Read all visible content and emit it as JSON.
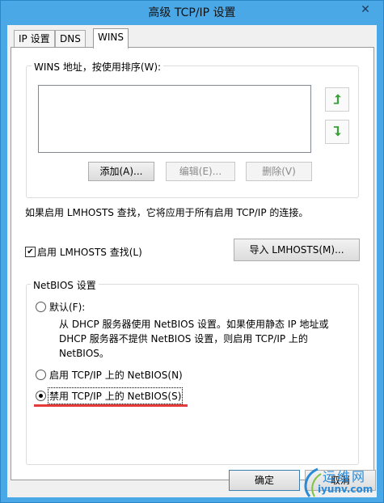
{
  "window": {
    "title": "高级 TCP/IP 设置",
    "close_label": "✕"
  },
  "tabs": [
    {
      "label": "IP 设置"
    },
    {
      "label": "DNS"
    },
    {
      "label": "WINS"
    }
  ],
  "wins_group": {
    "label": "WINS 地址，按使用排序(W):",
    "add_label": "添加(A)...",
    "edit_label": "编辑(E)...",
    "remove_label": "删除(V)"
  },
  "lmhosts_info": "如果启用 LMHOSTS 查找，它将应用于所有启用 TCP/IP 的连接。",
  "lmhosts_check": {
    "label": "启用 LMHOSTS 查找(L)",
    "checked": true
  },
  "import_label": "导入 LMHOSTS(M)...",
  "netbios_group": {
    "label": "NetBIOS 设置",
    "default_label": "默认(F):",
    "default_desc": [
      "从 DHCP 服务器使用 NetBIOS 设置。如果使用静态 IP 地址或",
      "DHCP 服务器不提供 NetBIOS 设置，则启用 TCP/IP 上的",
      "NetBIOS。"
    ],
    "enable_label": "启用 TCP/IP 上的 NetBIOS(N)",
    "disable_label": "禁用 TCP/IP 上的 NetBIOS(S)",
    "selected": "disable"
  },
  "footer": {
    "ok_label": "确定",
    "cancel_label": "取消"
  },
  "watermark": {
    "brand": "运维网",
    "url": "iyunv.com"
  },
  "colors": {
    "title_bar": "#4aa8e6",
    "arrow": "#35a235",
    "highlight": "#e53a3a"
  }
}
